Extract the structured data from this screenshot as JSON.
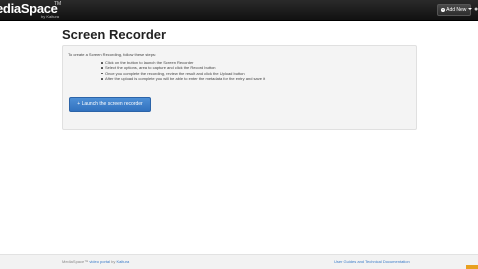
{
  "header": {
    "logo_text": "ediaSpace",
    "logo_tm": "TM",
    "logo_by": "by Kaltura",
    "add_new_label": "Add New",
    "add_new_icon": "plus-circle-icon",
    "user_icon": "user-icon"
  },
  "main": {
    "title": "Screen Recorder",
    "intro": "To create a Screen Recording, follow these steps:",
    "steps": [
      "Click on the button to launch the Screen Recorder",
      "Select the options, area to capture and click the Record button",
      "Once you complete the recording, review the result and click the Upload button",
      "After the upload is complete you will be able to enter the metadata for the entry and save it"
    ],
    "launch_button": "+ Launch the screen recorder"
  },
  "footer": {
    "left_prefix": "MediaSpace™ ",
    "left_link1": "video portal",
    "left_mid": " by ",
    "left_link2": "Kaltura",
    "right_link": "User Guides and Technical Documentation"
  }
}
